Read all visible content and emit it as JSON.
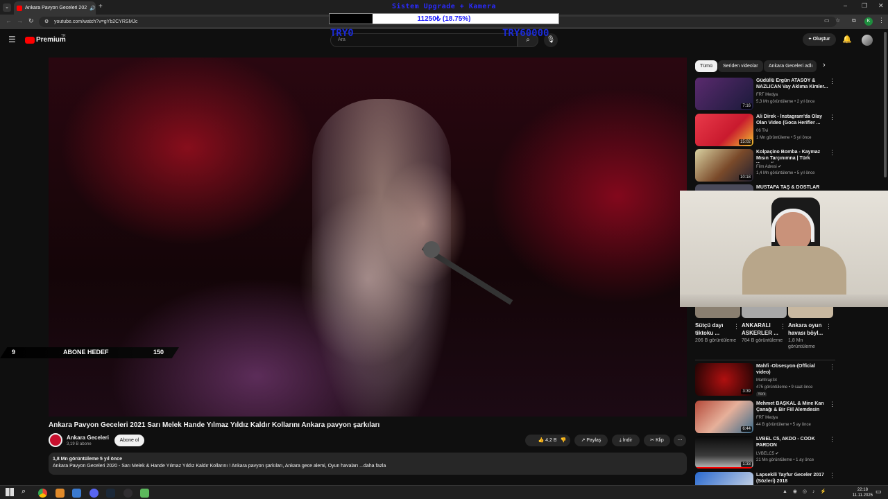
{
  "browser": {
    "tab_title": "Ankara Pavyon Geceleri 202",
    "url": "youtube.com/watch?v=gYb2CYRSMJc",
    "profile_initial": "K"
  },
  "stream_overlay": {
    "goal_title": "Sistem Upgrade + Kamera",
    "progress_text": "11250₺ (18.75%)",
    "progress_fraction": 0.1875,
    "min_label": "TRY0",
    "max_label": "TRY60000",
    "sub_goal": {
      "current": "9",
      "label": "ABONE HEDEF",
      "target": "150"
    }
  },
  "youtube": {
    "logo": "Premium",
    "logo_region": "TR",
    "search_placeholder": "Ara",
    "create_label": "Oluştur"
  },
  "video": {
    "title": "Ankara Pavyon Geceleri 2021 Sarı Melek Hande Yılmaz Yıldız Kaldır Kollarını Ankara pavyon şarkıları",
    "channel": "Ankara Geceleri",
    "subscribers": "3,19 B abone",
    "subscribe_label": "Abone ol",
    "likes": "4,2 B",
    "share_label": "Paylaş",
    "download_label": "İndir",
    "clip_label": "Klip",
    "views_line": "1,8 Mn görüntüleme  5 yıl önce",
    "description": "Ankara Pavyon Geceleri 2020 - Sarı Melek & Hande Yılmaz Yıldız Kaldır Kollarını  ! Ankara pavyon şarkıları, Ankara gece alemi, Oyun havaları ...daha fazla"
  },
  "sidebar": {
    "chips": [
      "Tümü",
      "Seriden videolar",
      "Ankara Geceleri adlı"
    ],
    "recs_top": [
      {
        "title": "Güdüllü Ergün ATASOY & NAZLICAN  Vay Aklıma Kimler...",
        "channel": "FRT Medya",
        "meta": "5,3 Mn görüntüleme • 2 yıl önce",
        "duration": "7:16"
      },
      {
        "title": "Ali Direk - İnstagram'da Olay Olan Video (Goca Herifler ...",
        "channel": "06 Tivi",
        "meta": "1 Mn görüntüleme • 5 yıl önce",
        "duration": "15:02"
      },
      {
        "title": "Kolpaçino Bomba - Kaymaz Mısın Tarçınımna | Türk Komedi...",
        "channel": "Film Adresi",
        "meta": "1,4 Mn görüntüleme • 5 yıl önce",
        "duration": "10:18"
      },
      {
        "title": "MUSTAFA TAŞ & DOSTLAR",
        "channel": "",
        "meta": "",
        "duration": ""
      }
    ],
    "shorts": [
      {
        "title": "Sütçü dayı tiktoku ...",
        "views": "206 B görüntüleme"
      },
      {
        "title": "ANKARALI ASKERLER ...",
        "views": "784 B görüntüleme"
      },
      {
        "title": "Ankara oyun havası böyl...",
        "views": "1,8 Mn görüntüleme"
      }
    ],
    "recs_bottom": [
      {
        "title": "Mahfi -Obsesyon-(Official video)",
        "channel": "Mahfirap34",
        "meta": "475 görüntüleme • 9 saat önce",
        "badge": "Yeni",
        "duration": "3:39"
      },
      {
        "title": "Mehmet BAŞKAL  & Mine   Kan Çanağı  &  Bir Fiil Alemdesin",
        "channel": "FRT Medya",
        "meta": "44 B görüntüleme • 5 ay önce",
        "duration": "6:44"
      },
      {
        "title": "LVBEL C5, AKDO - COOK PARDON",
        "channel": "LVBELC5",
        "meta": "21 Mn görüntüleme • 1 ay önce",
        "duration": "1:33"
      },
      {
        "title": "Lapsekili Tayfur Geceler 2017 (Sözleri) 2018",
        "channel": "",
        "meta": "",
        "duration": ""
      }
    ]
  },
  "taskbar": {
    "time": "22:18",
    "date": "11.11.2025"
  }
}
